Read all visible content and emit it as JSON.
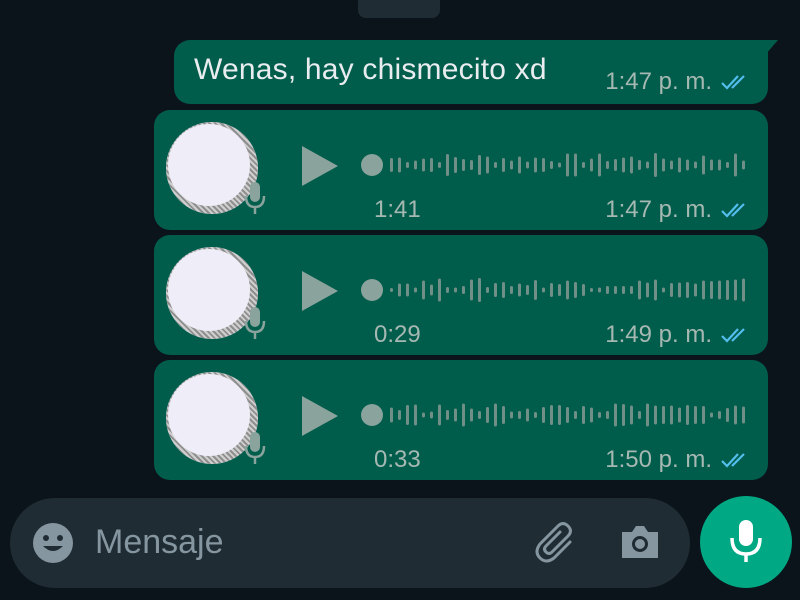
{
  "messages": [
    {
      "type": "text",
      "text": "Wenas, hay chismecito xd",
      "time": "1:47 p. m.",
      "status": "read"
    },
    {
      "type": "voice",
      "duration": "1:41",
      "time": "1:47 p. m.",
      "status": "read"
    },
    {
      "type": "voice",
      "duration": "0:29",
      "time": "1:49 p. m.",
      "status": "read"
    },
    {
      "type": "voice",
      "duration": "0:33",
      "time": "1:50 p. m.",
      "status": "read"
    }
  ],
  "composer": {
    "placeholder": "Mensaje",
    "icons": [
      "emoji-icon",
      "attach-icon",
      "camera-icon",
      "mic-icon"
    ]
  },
  "colors": {
    "background": "#0b141a",
    "bubble": "#005c4b",
    "composer": "#1f2c34",
    "accent": "#00a884",
    "read_tick": "#53bdeb"
  }
}
